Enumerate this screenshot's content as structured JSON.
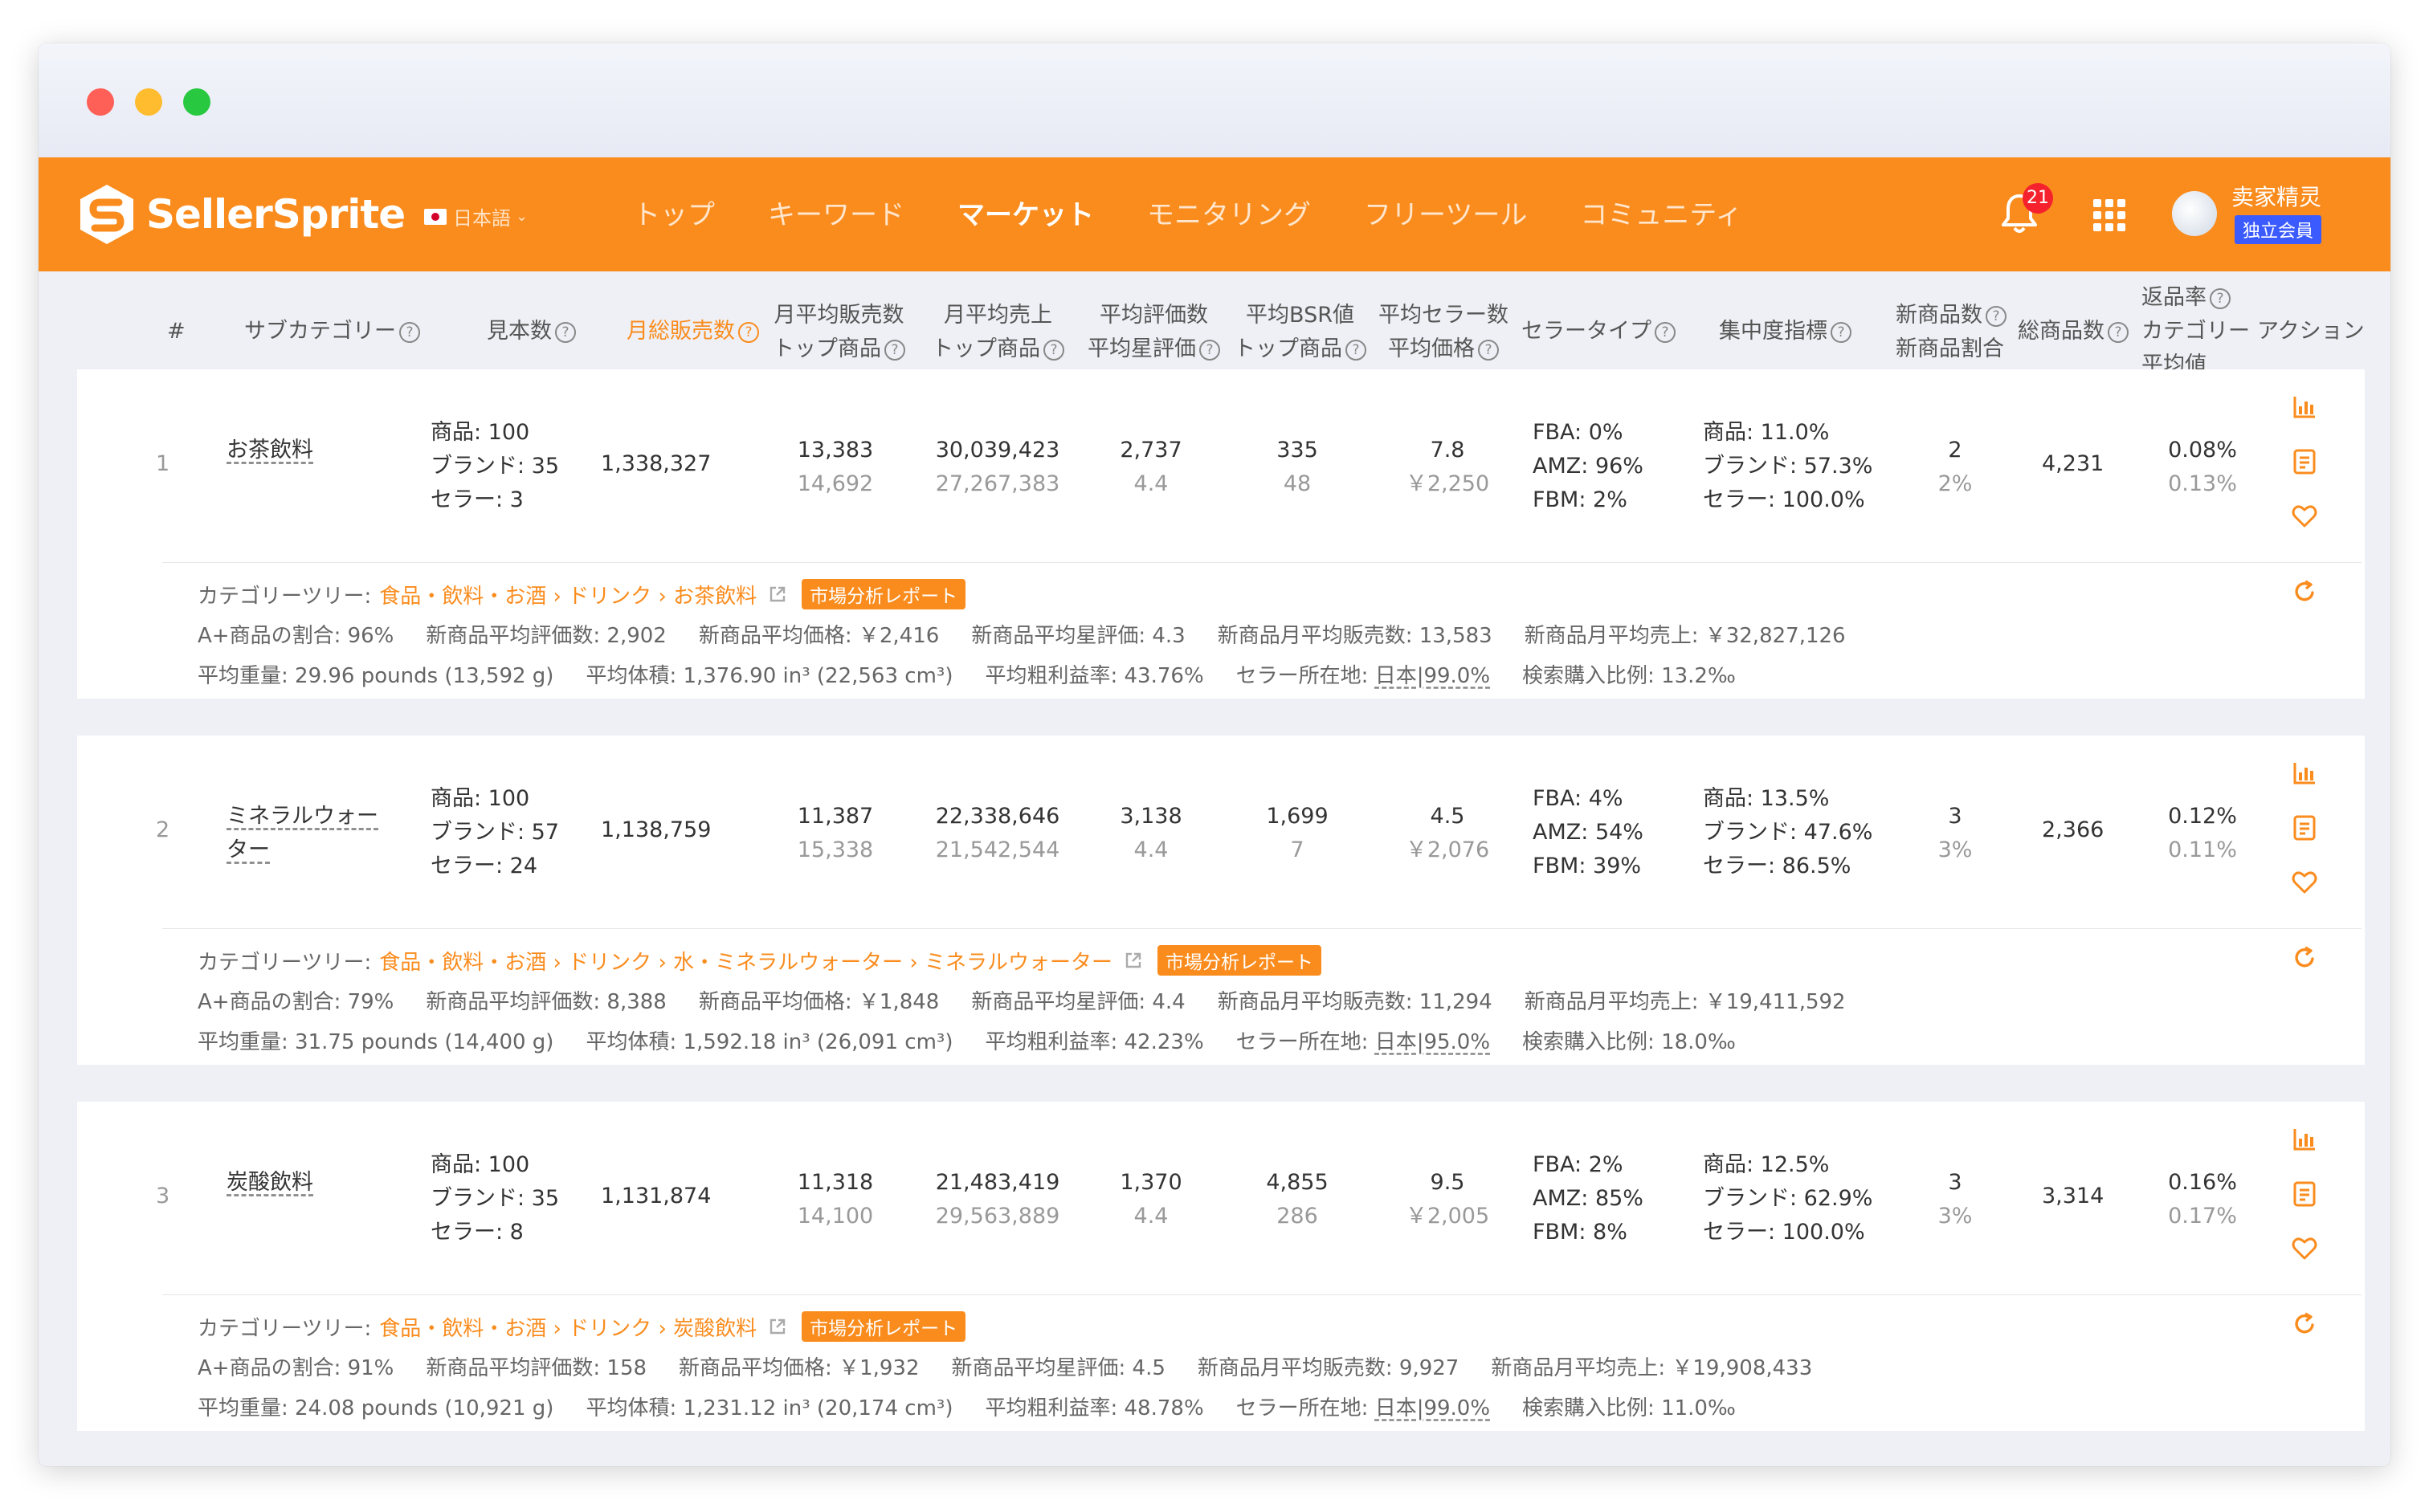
{
  "app": {
    "logo_text": "SellerSprite",
    "language": "日本語",
    "menu": [
      "トップ",
      "キーワード",
      "マーケット",
      "モニタリング",
      "フリーツール",
      "コミュニティ"
    ],
    "active_menu": "マーケット",
    "notification_count": "21",
    "user_name": "卖家精灵",
    "member_badge": "独立会員"
  },
  "table": {
    "headers": {
      "rank": "#",
      "subcategory": "サブカテゴリー",
      "sample": "見本数",
      "monthly_sales": "月総販売数",
      "avg_sales_l1": "月平均販売数",
      "avg_sales_l2": "トップ商品",
      "avg_revenue_l1": "月平均売上",
      "avg_revenue_l2": "トップ商品",
      "reviews_l1": "平均評価数",
      "reviews_l2": "平均星評価",
      "bsr_l1": "平均BSR値",
      "bsr_l2": "トップ商品",
      "sellers_l1": "平均セラー数",
      "sellers_l2": "平均価格",
      "seller_type": "セラータイプ",
      "concentration": "集中度指標",
      "new_l1": "新商品数",
      "new_l2": "新商品割合",
      "total": "総商品数",
      "return_l1": "返品率",
      "return_l2": "カテゴリー",
      "return_l3": "平均値",
      "action": "アクション"
    },
    "rows": [
      {
        "rank": "1",
        "name_l1": "お茶飲料",
        "name_l2": "",
        "products": "商品: 100",
        "brands": "ブランド: 35",
        "sellers": "セラー: 3",
        "monthly_sales": "1,338,327",
        "avg_sales": "13,383",
        "top_sales": "14,692",
        "avg_revenue": "30,039,423",
        "top_revenue": "27,267,383",
        "reviews": "2,737",
        "stars": "4.4",
        "bsr": "335",
        "top_bsr": "48",
        "seller_count": "7.8",
        "avg_price": "￥2,250",
        "fba": "FBA: 0%",
        "amz": "AMZ: 96%",
        "fbm": "FBM: 2%",
        "conc_product": "商品: 11.0%",
        "conc_brand": "ブランド: 57.3%",
        "conc_seller": "セラー: 100.0%",
        "new_count": "2",
        "new_ratio": "2%",
        "total": "4,231",
        "return_rate": "0.08%",
        "return_avg": "0.13%",
        "tree_label": "カテゴリーツリー:",
        "tree_path": "食品・飲料・お酒 › ドリンク › お茶飲料",
        "report": "市場分析レポート",
        "aplus": "A+商品の割合: 96%",
        "new_reviews": "新商品平均評価数: 2,902",
        "new_price": "新商品平均価格: ￥2,416",
        "new_stars": "新商品平均星評価: 4.3",
        "new_sales": "新商品月平均販売数: 13,583",
        "new_revenue": "新商品月平均売上: ￥32,827,126",
        "weight": "平均重量: 29.96 pounds (13,592 g)",
        "volume": "平均体積: 1,376.90 in³ (22,563 cm³)",
        "margin": "平均粗利益率: 43.76%",
        "location_label": "セラー所在地: ",
        "location_value": "日本|99.0%",
        "search_ratio": "検索購入比例: 13.2‰"
      },
      {
        "rank": "2",
        "name_l1": "ミネラルウォー",
        "name_l2": "ター",
        "products": "商品: 100",
        "brands": "ブランド: 57",
        "sellers": "セラー: 24",
        "monthly_sales": "1,138,759",
        "avg_sales": "11,387",
        "top_sales": "15,338",
        "avg_revenue": "22,338,646",
        "top_revenue": "21,542,544",
        "reviews": "3,138",
        "stars": "4.4",
        "bsr": "1,699",
        "top_bsr": "7",
        "seller_count": "4.5",
        "avg_price": "￥2,076",
        "fba": "FBA: 4%",
        "amz": "AMZ: 54%",
        "fbm": "FBM: 39%",
        "conc_product": "商品: 13.5%",
        "conc_brand": "ブランド: 47.6%",
        "conc_seller": "セラー: 86.5%",
        "new_count": "3",
        "new_ratio": "3%",
        "total": "2,366",
        "return_rate": "0.12%",
        "return_avg": "0.11%",
        "tree_label": "カテゴリーツリー:",
        "tree_path": "食品・飲料・お酒 › ドリンク › 水・ミネラルウォーター › ミネラルウォーター",
        "report": "市場分析レポート",
        "aplus": "A+商品の割合: 79%",
        "new_reviews": "新商品平均評価数: 8,388",
        "new_price": "新商品平均価格: ￥1,848",
        "new_stars": "新商品平均星評価: 4.4",
        "new_sales": "新商品月平均販売数: 11,294",
        "new_revenue": "新商品月平均売上: ￥19,411,592",
        "weight": "平均重量: 31.75 pounds (14,400 g)",
        "volume": "平均体積: 1,592.18 in³ (26,091 cm³)",
        "margin": "平均粗利益率: 42.23%",
        "location_label": "セラー所在地: ",
        "location_value": "日本|95.0%",
        "search_ratio": "検索購入比例: 18.0‰"
      },
      {
        "rank": "3",
        "name_l1": "炭酸飲料",
        "name_l2": "",
        "products": "商品: 100",
        "brands": "ブランド: 35",
        "sellers": "セラー: 8",
        "monthly_sales": "1,131,874",
        "avg_sales": "11,318",
        "top_sales": "14,100",
        "avg_revenue": "21,483,419",
        "top_revenue": "29,563,889",
        "reviews": "1,370",
        "stars": "4.4",
        "bsr": "4,855",
        "top_bsr": "286",
        "seller_count": "9.5",
        "avg_price": "￥2,005",
        "fba": "FBA: 2%",
        "amz": "AMZ: 85%",
        "fbm": "FBM: 8%",
        "conc_product": "商品: 12.5%",
        "conc_brand": "ブランド: 62.9%",
        "conc_seller": "セラー: 100.0%",
        "new_count": "3",
        "new_ratio": "3%",
        "total": "3,314",
        "return_rate": "0.16%",
        "return_avg": "0.17%",
        "tree_label": "カテゴリーツリー:",
        "tree_path": "食品・飲料・お酒 › ドリンク › 炭酸飲料",
        "report": "市場分析レポート",
        "aplus": "A+商品の割合: 91%",
        "new_reviews": "新商品平均評価数: 158",
        "new_price": "新商品平均価格: ￥1,932",
        "new_stars": "新商品平均星評価: 4.5",
        "new_sales": "新商品月平均販売数: 9,927",
        "new_revenue": "新商品月平均売上: ￥19,908,433",
        "weight": "平均重量: 24.08 pounds (10,921 g)",
        "volume": "平均体積: 1,231.12 in³ (20,174 cm³)",
        "margin": "平均粗利益率: 48.78%",
        "location_label": "セラー所在地: ",
        "location_value": "日本|99.0%",
        "search_ratio": "検索購入比例: 11.0‰"
      }
    ]
  },
  "colors": {
    "brand": "#fa8c1e",
    "badge": "#f5222d",
    "member": "#3b5bff"
  },
  "icons": [
    "bell-icon",
    "apps-grid-icon",
    "chart-icon",
    "report-icon",
    "heart-icon",
    "refresh-icon",
    "external-link-icon",
    "help-icon"
  ]
}
